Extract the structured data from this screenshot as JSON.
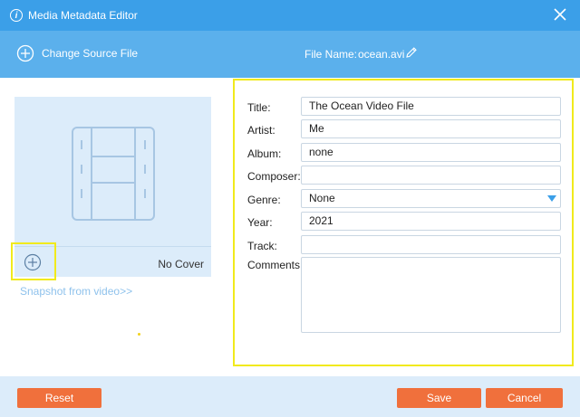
{
  "window": {
    "title": "Media Metadata Editor",
    "icons": {
      "info": "info-icon",
      "close": "close-icon"
    }
  },
  "toolbar": {
    "change_source_label": "Change Source File",
    "file_name_caption": "File Name:",
    "file_name": "ocean.avi",
    "icons": {
      "add": "plus-circle-icon",
      "edit": "pencil-icon"
    }
  },
  "cover": {
    "no_cover_label": "No Cover",
    "snapshot_link": "Snapshot from video>>",
    "icons": {
      "placeholder": "film-strip-icon",
      "add": "plus-circle-icon"
    }
  },
  "fields": {
    "title": {
      "label": "Title:",
      "value": "The Ocean Video File"
    },
    "artist": {
      "label": "Artist:",
      "value": "Me"
    },
    "album": {
      "label": "Album:",
      "value": "none"
    },
    "composer": {
      "label": "Composer:",
      "value": ""
    },
    "genre": {
      "label": "Genre:",
      "value": "None"
    },
    "year": {
      "label": "Year:",
      "value": "2021"
    },
    "track": {
      "label": "Track:",
      "value": ""
    },
    "comments": {
      "label": "Comments:",
      "value": ""
    }
  },
  "footer": {
    "reset_label": "Reset",
    "save_label": "Save",
    "cancel_label": "Cancel"
  },
  "colors": {
    "titlebar": "#3b9fe8",
    "toolbar": "#5bb0ec",
    "panel": "#dcecfa",
    "accent_button": "#f0703c",
    "highlight": "#f1ea1c"
  }
}
